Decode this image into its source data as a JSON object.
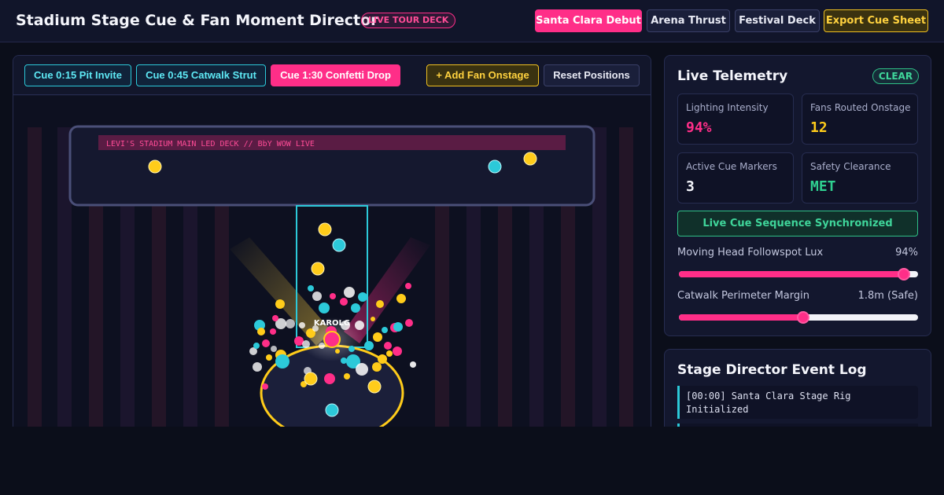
{
  "header": {
    "title": "Stadium Stage Cue & Fan Moment Director",
    "badge": "LIVE TOUR DECK",
    "presets": [
      "Santa Clara Debut",
      "Arena Thrust",
      "Festival Deck"
    ],
    "active_preset": "Santa Clara Debut",
    "export_label": "Export Cue Sheet"
  },
  "stage_toolbar": {
    "cues": [
      {
        "label": "Cue 0:15 Pit Invite",
        "active": false
      },
      {
        "label": "Cue 0:45 Catwalk Strut",
        "active": false
      },
      {
        "label": "Cue 1:30 Confetti Drop",
        "active": true
      }
    ],
    "add_fan_label": "+ Add Fan Onstage",
    "reset_label": "Reset Positions"
  },
  "stage": {
    "led_banner": "LEVI'S STADIUM MAIN LED DECK // BbY WOW LIVE",
    "performer_label": "KAROLG"
  },
  "telemetry": {
    "title": "Live Telemetry",
    "status_badge": "CLEAR",
    "stats": [
      {
        "label": "Lighting Intensity",
        "value": "94%",
        "color": "#ff2e88"
      },
      {
        "label": "Fans Routed Onstage",
        "value": "12",
        "color": "#ffcc1a"
      },
      {
        "label": "Active Cue Markers",
        "value": "3",
        "color": "#f4f5fb"
      },
      {
        "label": "Safety Clearance",
        "value": "MET",
        "color": "#2fd090"
      }
    ],
    "sync_status": "Live Cue Sequence Synchronized",
    "sliders": [
      {
        "label": "Moving Head Followspot Lux",
        "value": "94%",
        "level": 0.94
      },
      {
        "label": "Catwalk Perimeter Margin",
        "value": "1.8m (Safe)",
        "level": 0.52
      }
    ]
  },
  "event_log": {
    "title": "Stage Director Event Log",
    "entries": [
      "[00:00] Santa Clara Stage Rig Initialized"
    ]
  },
  "colors": {
    "accent_pink": "#ff2e88",
    "accent_cyan": "#2cc9d9",
    "accent_yellow": "#ffcc1a",
    "status_green": "#2fd090"
  }
}
